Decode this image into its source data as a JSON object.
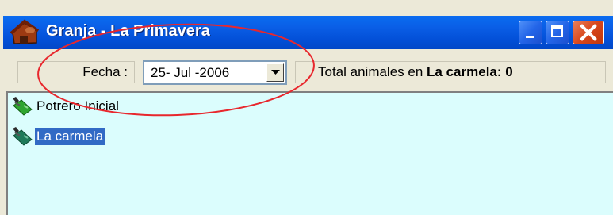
{
  "window": {
    "title": "Granja - La Primavera",
    "app_icon": "farm-house-icon"
  },
  "titlebar_buttons": {
    "minimize": "minimize-icon",
    "maximize": "maximize-icon",
    "close": "close-icon"
  },
  "toolbar": {
    "fecha_label": "Fecha :",
    "date_value": "25- Jul -2006",
    "total_prefix": "Total animales en ",
    "total_value": "La carmela: 0"
  },
  "tree": {
    "items": [
      {
        "label": "Potrero Inicial",
        "icon": "pasture-icon",
        "selected": false
      },
      {
        "label": "La carmela",
        "icon": "pasture-icon",
        "selected": true
      }
    ]
  },
  "colors": {
    "titlebar": "#0350d8",
    "content_bg": "#dbfdfd",
    "selection": "#316ac5",
    "annotation": "#e8272d"
  }
}
